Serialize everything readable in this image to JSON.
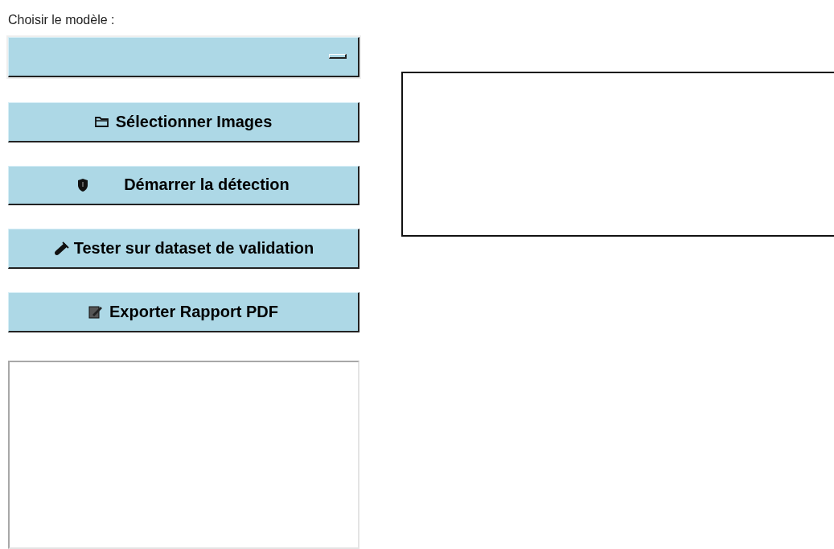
{
  "model_label": "Choisir le modèle :",
  "buttons": [
    {
      "label": "Sélectionner Images"
    },
    {
      "label": "Démarrer la détection"
    },
    {
      "label": "Tester sur dataset de validation"
    },
    {
      "label": "Exporter Rapport PDF"
    }
  ]
}
